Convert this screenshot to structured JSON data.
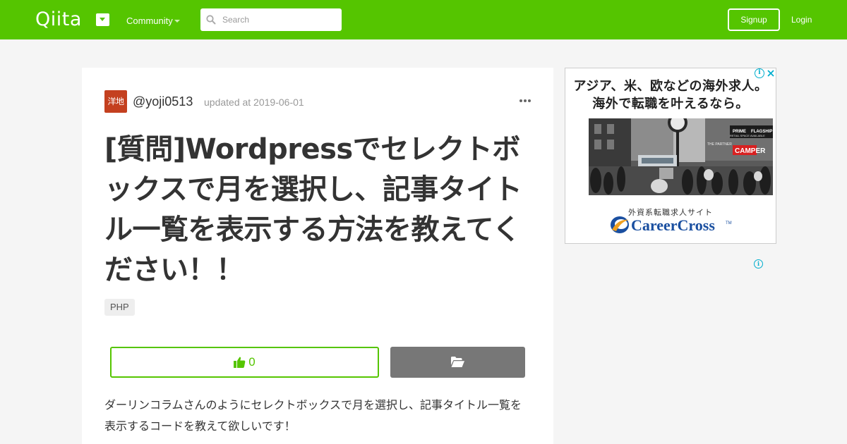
{
  "colors": {
    "brand": "#55c500",
    "avatar": "#c4401f",
    "stock": "#777777",
    "ad_brand": "#1a4fa0"
  },
  "header": {
    "logo": "Qiita",
    "community_label": "Community",
    "search_placeholder": "Search",
    "signup_label": "Signup",
    "login_label": "Login"
  },
  "article": {
    "avatar_text": "洋地",
    "author": "@yoji0513",
    "updated": "updated at 2019-06-01",
    "title": "[質問]Wordpressでセレクトボックスで月を選択し、記事タイトル一覧を表示する方法を教えてください！！",
    "tags": [
      "PHP"
    ],
    "like_count": "0",
    "body": "ダーリンコラムさんのようにセレクトボックスで月を選択し、記事タイトル一覧を表示するコードを教えて欲しいです！"
  },
  "ad": {
    "headline_line1": "アジア、米、欧などの海外求人。",
    "headline_line2": "海外で転職を叶えるなら。",
    "subtitle": "外資系転職求人サイト",
    "brand": "CareerCross",
    "brand_tm": "TM",
    "info_glyph": "i",
    "photo_signs": [
      "PRIME",
      "FLAGSHIP",
      "RETAIL SPACE AVAILABLE",
      "CAMPER",
      "THE PARTNER"
    ]
  }
}
